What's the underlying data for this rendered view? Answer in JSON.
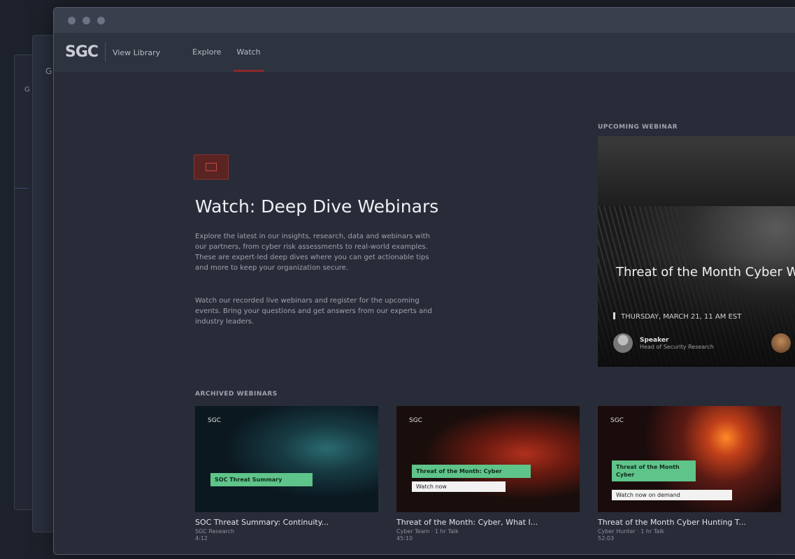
{
  "background_windows": {
    "logo_a": "G",
    "logo_b": "G"
  },
  "navbar": {
    "logo": "SGC",
    "label": "View Library",
    "tabs": [
      {
        "label": "Explore",
        "active": false
      },
      {
        "label": "Watch",
        "active": true
      }
    ],
    "accent_color": "#8b2a2a"
  },
  "hero": {
    "badge_icon": "webinar-icon",
    "title": "Watch: Deep Dive Webinars",
    "description": "Explore the latest in our insights, research, data and webinars with our partners, from cyber risk assessments to real-world examples. These are expert-led deep dives where you can get actionable tips and more to keep your organization secure.",
    "description2": "Watch our recorded live webinars and register for the upcoming events. Bring your questions and get answers from our experts and industry leaders."
  },
  "upcoming": {
    "section_label": "UPCOMING WEBINAR",
    "title": "Threat of the Month Cyber Warfare",
    "date": "THURSDAY, MARCH 21, 11 AM EST",
    "speaker_name": "Speaker",
    "speaker_role": "Head of Security Research"
  },
  "archived": {
    "section_label": "ARCHIVED WEBINARS",
    "cards": [
      {
        "tag": "SGC",
        "thumb_text": "SOC Threat Summary",
        "title": "SOC Threat Summary: Continuity...",
        "meta": "SGC Research",
        "meta2": "4:12"
      },
      {
        "tag": "SGC",
        "thumb_text": "Threat of the Month: Cyber",
        "thumb_text2": "Watch now",
        "title": "Threat of the Month: Cyber, What I...",
        "meta": "Cyber Team · 1 hr Talk",
        "meta2": "45:10"
      },
      {
        "tag": "SGC",
        "thumb_text": "Threat of the Month Cyber",
        "thumb_text2": "Watch now on demand",
        "title": "Threat of the Month Cyber Hunting T...",
        "meta": "Cyber Hunter · 1 hr Talk",
        "meta2": "52:03"
      }
    ]
  }
}
